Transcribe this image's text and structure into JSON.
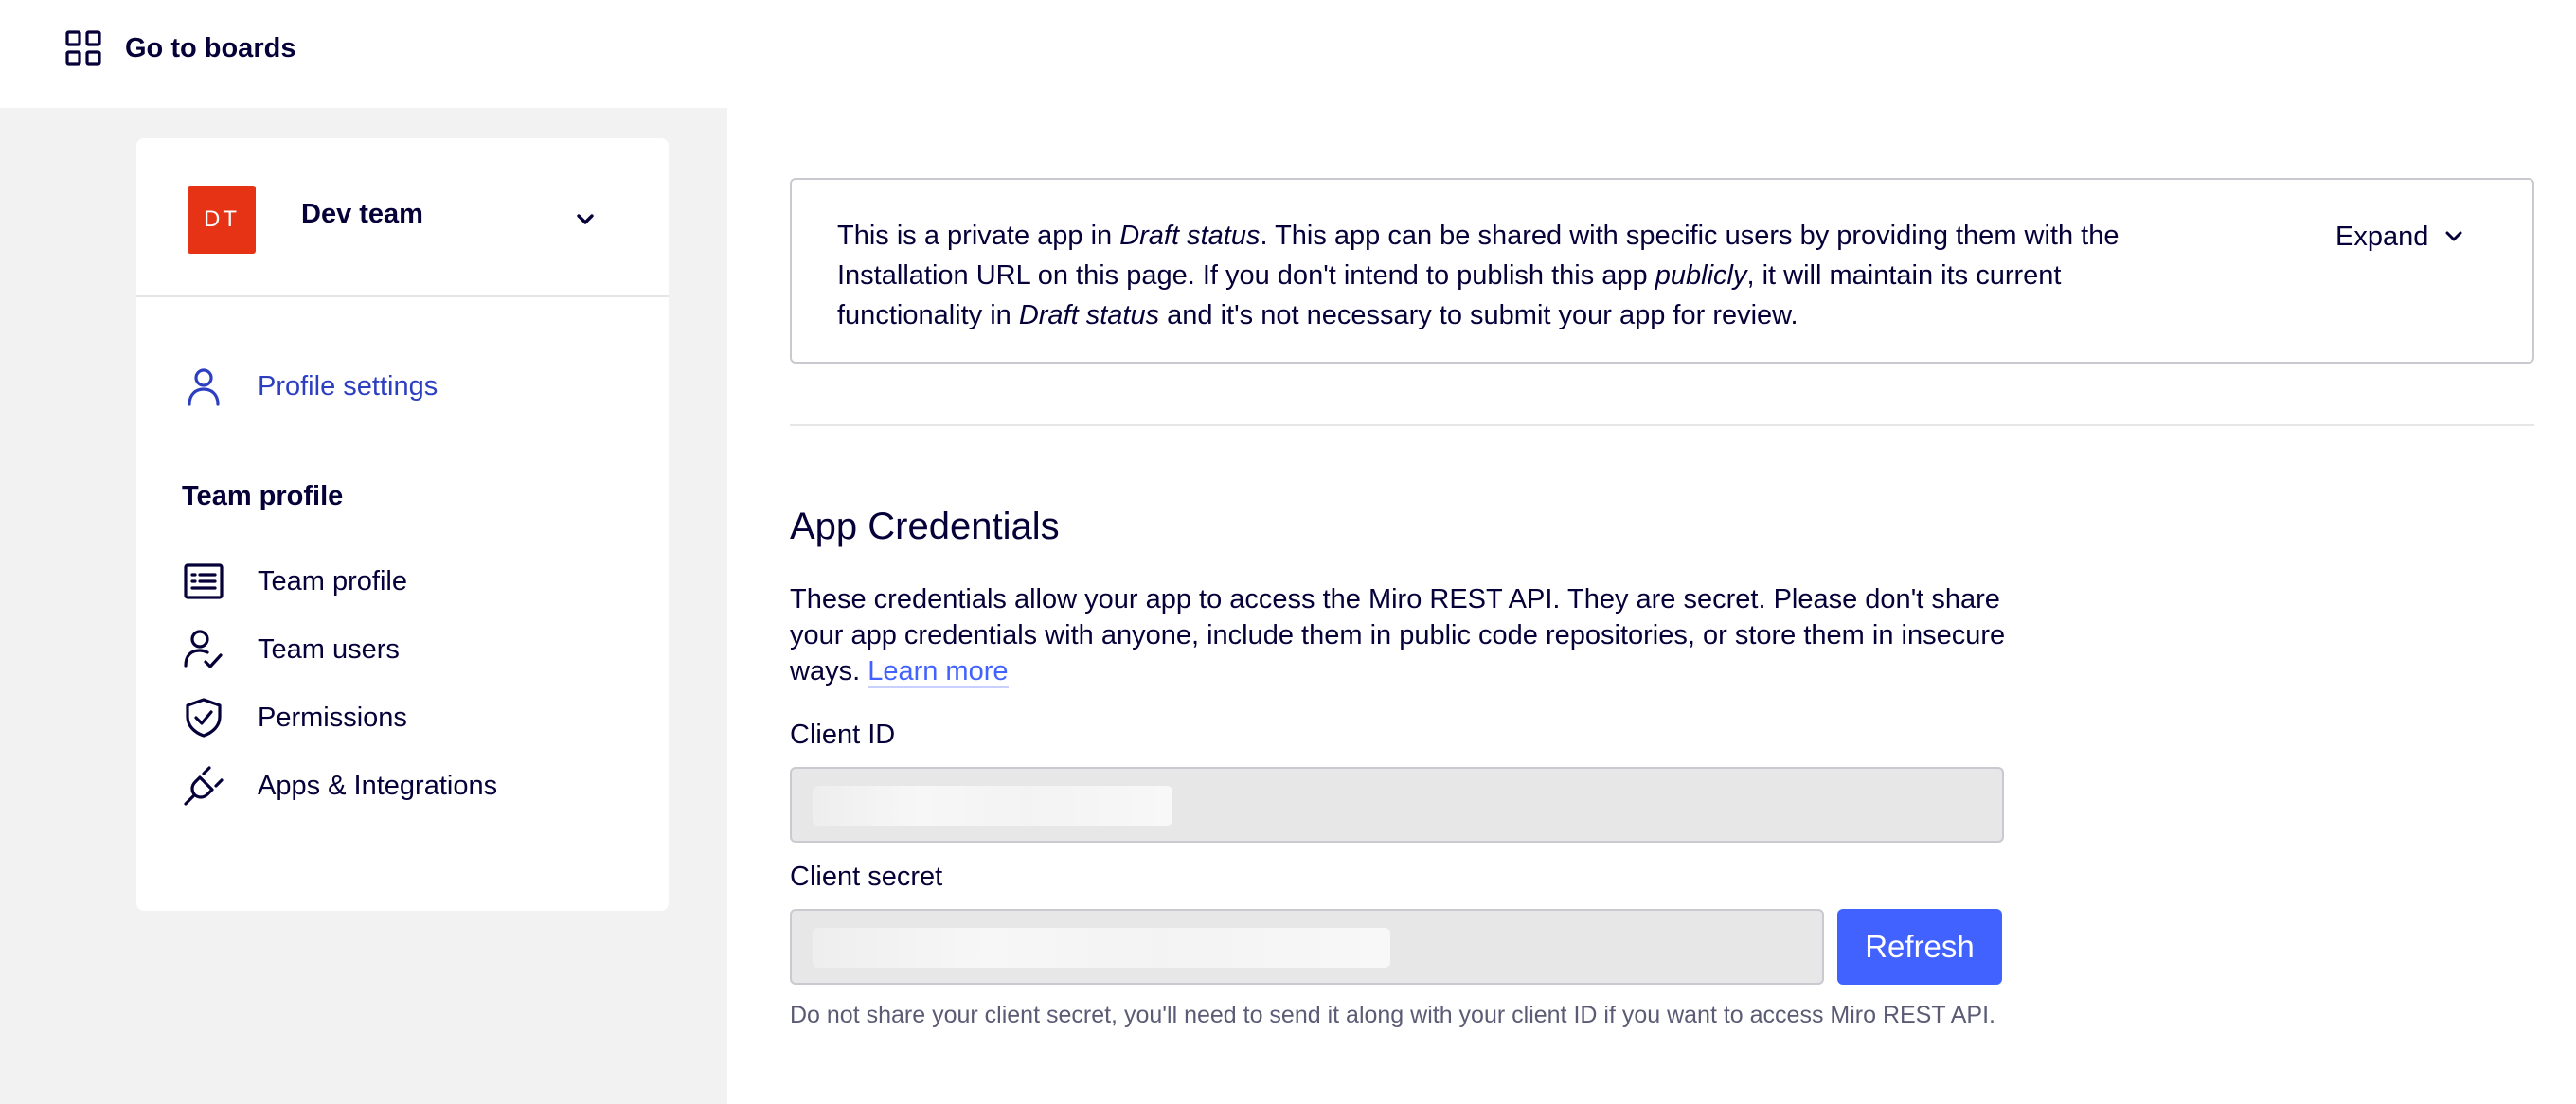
{
  "topbar": {
    "goto_label": "Go to boards",
    "goto_icon": "grid-icon"
  },
  "sidebar": {
    "team": {
      "initials": "DT",
      "name": "Dev team",
      "avatar_color": "#e63316"
    },
    "profile_settings": "Profile settings",
    "section_title": "Team profile",
    "items": [
      {
        "label": "Team profile",
        "icon": "list-icon"
      },
      {
        "label": "Team users",
        "icon": "user-check-icon"
      },
      {
        "label": "Permissions",
        "icon": "shield-check-icon"
      },
      {
        "label": "Apps & Integrations",
        "icon": "plug-icon"
      }
    ]
  },
  "notice": {
    "part1": "This is a private app in ",
    "em1": "Draft status",
    "part2": ". This app can be shared with specific users by providing them with the Installation URL on this page. If you don't intend to publish this app ",
    "em2": "publicly",
    "part3": ", it will maintain its current functionality in ",
    "em3": "Draft status",
    "part4": " and it's not necessary to submit your app for review.",
    "expand_label": "Expand"
  },
  "credentials": {
    "title": "App Credentials",
    "description": "These credentials allow your app to access the Miro REST API. They are secret. Please don't share your app credentials with anyone, include them in public code repositories, or store them in insecure ways. ",
    "learn_more": "Learn more",
    "client_id_label": "Client ID",
    "client_secret_label": "Client secret",
    "refresh_label": "Refresh",
    "hint": "Do not share your client secret, you'll need to send it along with your client ID if you want to access Miro REST API."
  },
  "colors": {
    "primary": "#4262ff",
    "active_nav": "#2d3fc1",
    "text": "#050038"
  }
}
